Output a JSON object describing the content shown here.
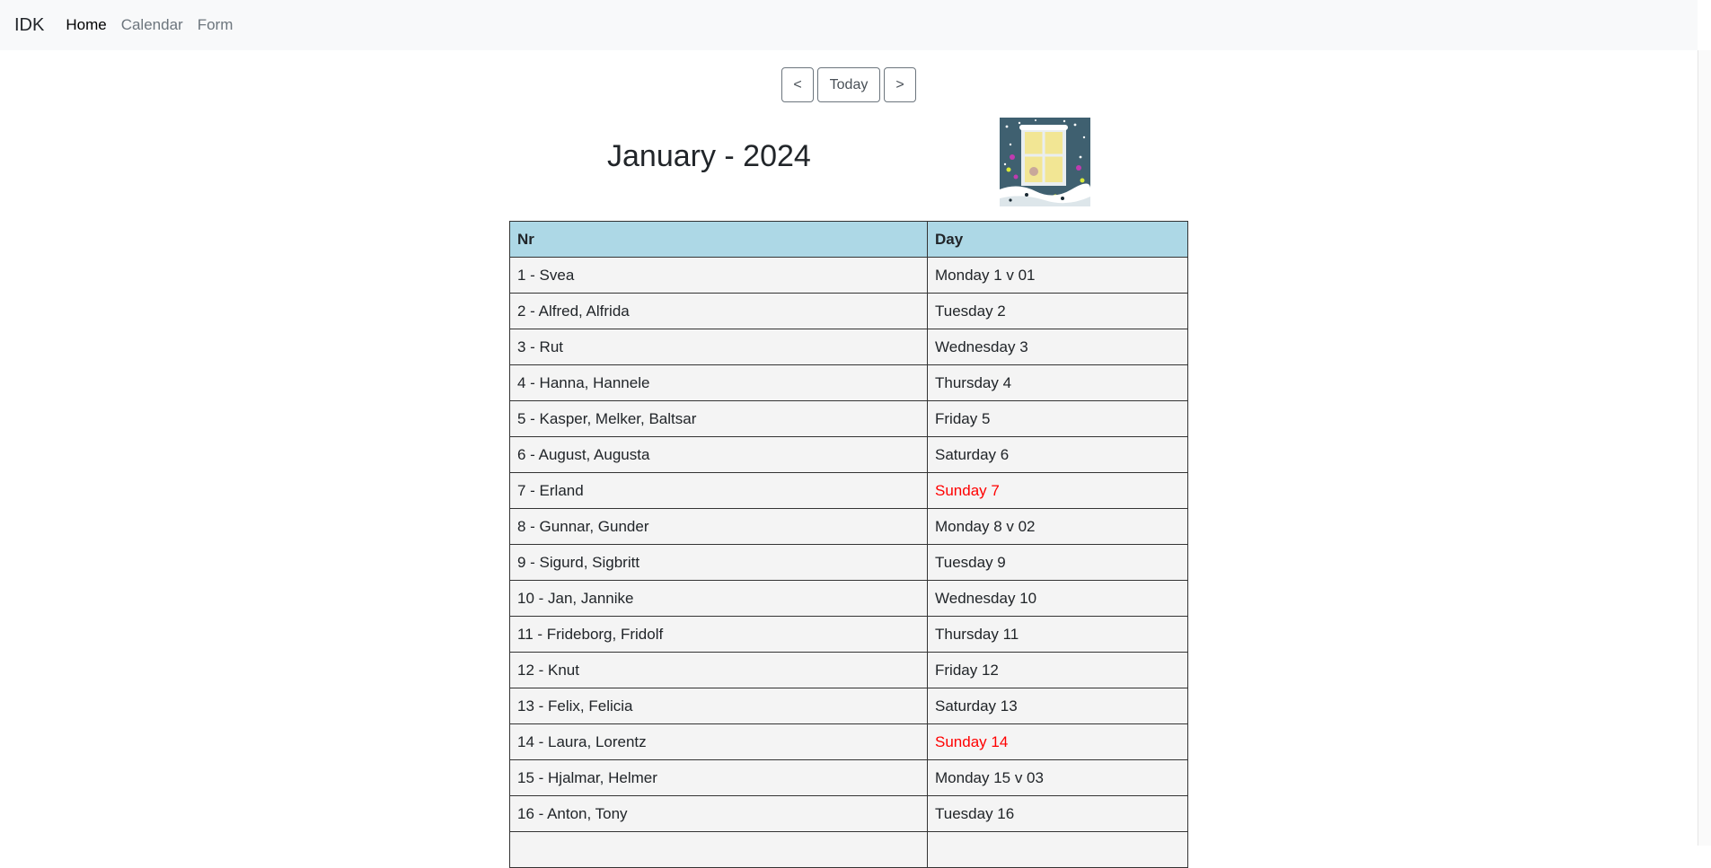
{
  "nav": {
    "brand": "IDK",
    "links": [
      "Home",
      "Calendar",
      "Form"
    ]
  },
  "controls": {
    "prev": "<",
    "today": "Today",
    "next": ">"
  },
  "title": "January - 2024",
  "image": {
    "icon": "snowy-window-illustration",
    "colors": {
      "sky": "#3f6070",
      "window": "#f2e694",
      "snow": "#ffffff"
    }
  },
  "table": {
    "headers": [
      "Nr",
      "Day"
    ],
    "sunday_color": "#ff0000",
    "header_color": "#add8e6",
    "rows": [
      {
        "nr": "1 - Svea",
        "day": "Monday 1 v 01"
      },
      {
        "nr": "2 - Alfred, Alfrida",
        "day": "Tuesday 2"
      },
      {
        "nr": "3 - Rut",
        "day": "Wednesday 3"
      },
      {
        "nr": "4 - Hanna, Hannele",
        "day": "Thursday 4"
      },
      {
        "nr": "5 - Kasper, Melker, Baltsar",
        "day": "Friday 5"
      },
      {
        "nr": "6 - August, Augusta",
        "day": "Saturday 6"
      },
      {
        "nr": "7 - Erland",
        "day": "Sunday 7",
        "sunday": true
      },
      {
        "nr": "8 - Gunnar, Gunder",
        "day": "Monday 8 v 02"
      },
      {
        "nr": "9 - Sigurd, Sigbritt",
        "day": "Tuesday 9"
      },
      {
        "nr": "10 - Jan, Jannike",
        "day": "Wednesday 10"
      },
      {
        "nr": "11 - Frideborg, Fridolf",
        "day": "Thursday 11"
      },
      {
        "nr": "12 - Knut",
        "day": "Friday 12"
      },
      {
        "nr": "13 - Felix, Felicia",
        "day": "Saturday 13"
      },
      {
        "nr": "14 - Laura, Lorentz",
        "day": "Sunday 14",
        "sunday": true
      },
      {
        "nr": "15 - Hjalmar, Helmer",
        "day": "Monday 15 v 03"
      },
      {
        "nr": "16 - Anton, Tony",
        "day": "Tuesday 16"
      },
      {
        "nr": "",
        "day": ""
      }
    ]
  }
}
